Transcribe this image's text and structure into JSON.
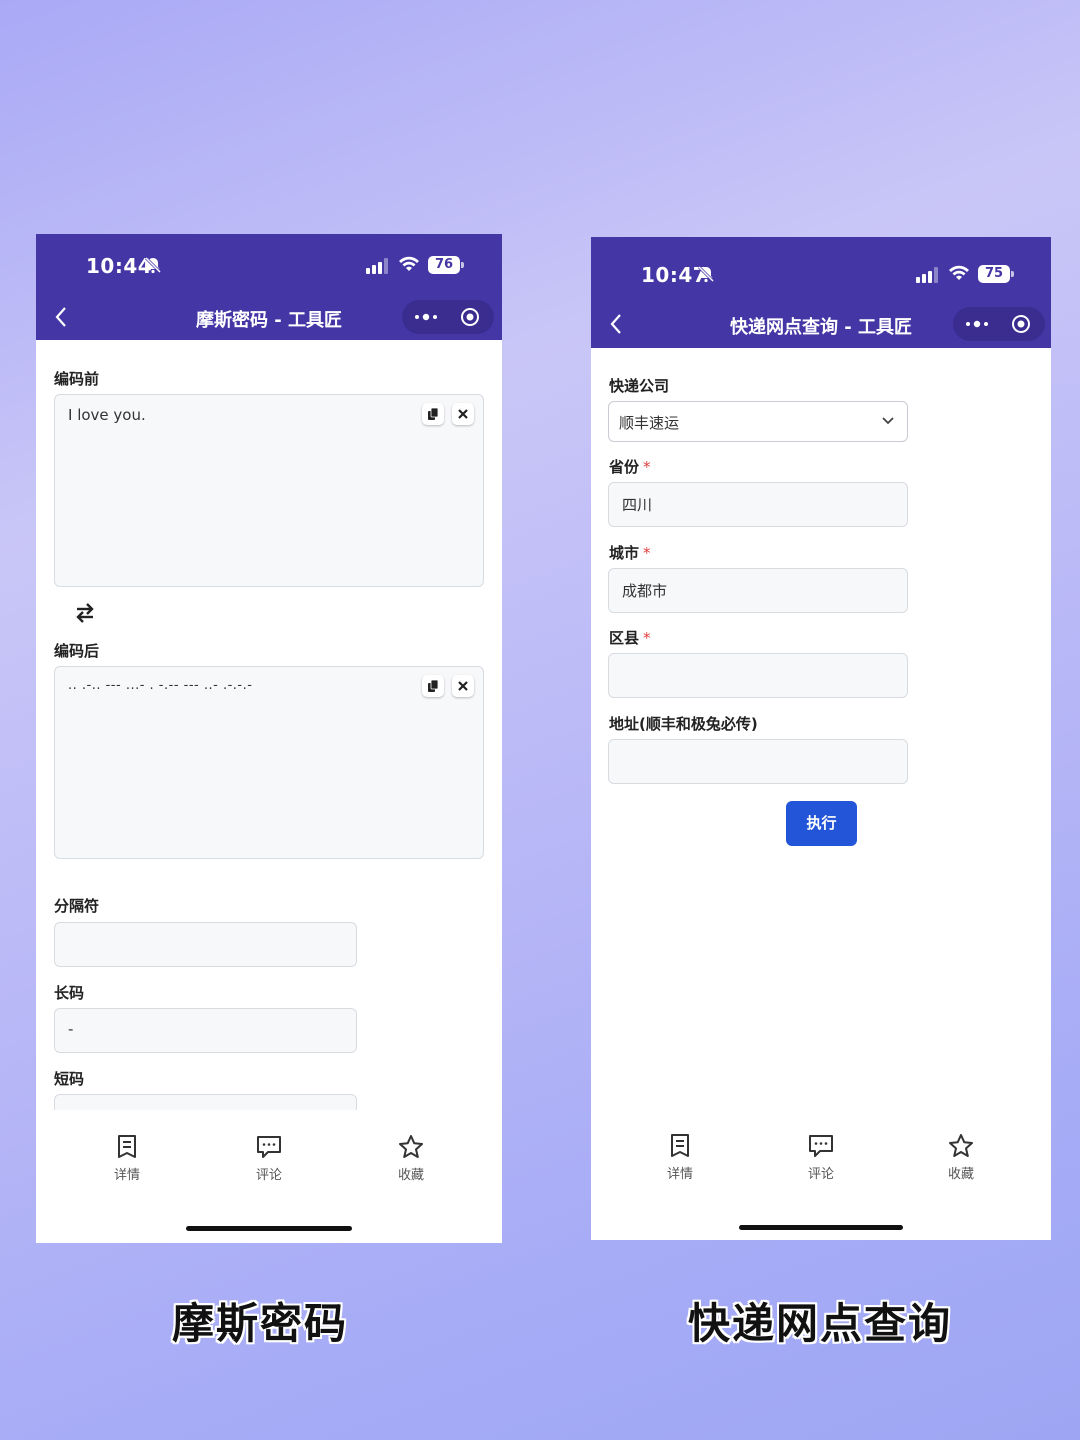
{
  "left": {
    "status": {
      "time": "10:44",
      "battery": "76"
    },
    "nav": {
      "title": "摩斯密码 - 工具匠"
    },
    "fields": {
      "before_label": "编码前",
      "before_value": "I love you.",
      "after_label": "编码后",
      "after_value": ".. .-.. --- ...- . -.-- --- ..- .-.-.-",
      "separator_label": "分隔符",
      "separator_value": "",
      "long_label": "长码",
      "long_value": "-",
      "short_label": "短码"
    },
    "tabs": [
      {
        "label": "详情",
        "icon": "document-icon"
      },
      {
        "label": "评论",
        "icon": "comment-icon"
      },
      {
        "label": "收藏",
        "icon": "star-icon"
      }
    ]
  },
  "right": {
    "status": {
      "time": "10:47",
      "battery": "75"
    },
    "nav": {
      "title": "快递网点查询 - 工具匠"
    },
    "form": {
      "company_label": "快递公司",
      "company_value": "顺丰速运",
      "province_label": "省份",
      "province_value": "四川",
      "city_label": "城市",
      "city_value": "成都市",
      "district_label": "区县",
      "district_value": "",
      "address_label": "地址(顺丰和极兔必传)",
      "address_value": "",
      "required_mark": "*",
      "submit_label": "执行"
    },
    "tabs": [
      {
        "label": "详情",
        "icon": "document-icon"
      },
      {
        "label": "评论",
        "icon": "comment-icon"
      },
      {
        "label": "收藏",
        "icon": "star-icon"
      }
    ]
  },
  "captions": {
    "left": "摩斯密码",
    "right": "快递网点查询"
  },
  "colors": {
    "header": "#4536a6",
    "primary_button": "#2255d8",
    "required": "#e03c3c"
  }
}
